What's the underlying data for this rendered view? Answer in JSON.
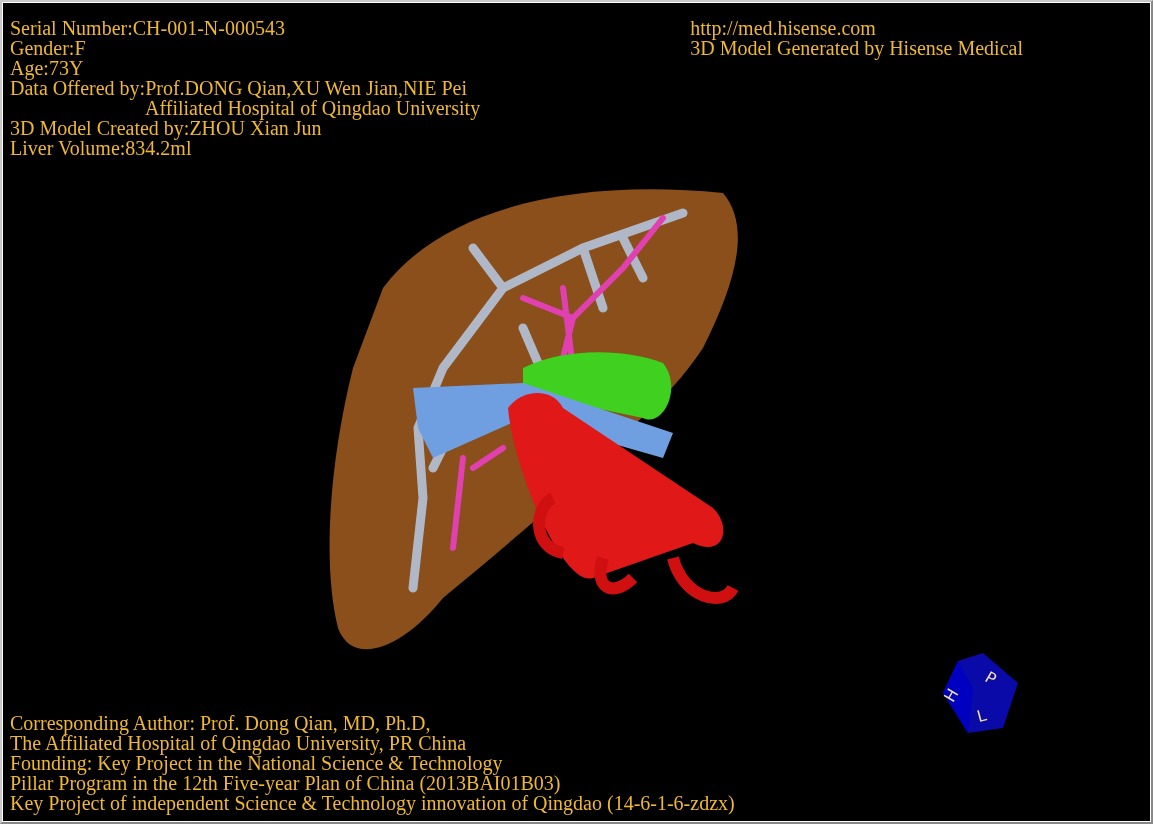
{
  "info_left": [
    {
      "text": "Serial Number:CH-001-N-000543",
      "indented": false
    },
    {
      "text": "Gender:F",
      "indented": false
    },
    {
      "text": "Age:73Y",
      "indented": false
    },
    {
      "text": "Data Offered by:Prof.DONG Qian,XU Wen Jian,NIE Pei",
      "indented": false
    },
    {
      "text": "Affiliated Hospital of Qingdao University",
      "indented": true
    },
    {
      "text": "3D Model Created by:ZHOU Xian Jun",
      "indented": false
    },
    {
      "text": "Liver Volume:834.2ml",
      "indented": false
    }
  ],
  "info_right": [
    "http://med.hisense.com",
    "3D Model Generated by Hisense Medical"
  ],
  "footer": [
    "Corresponding Author: Prof. Dong Qian, MD, Ph.D,",
    "The Affiliated Hospital of Qingdao University, PR China",
    "Founding: Key Project in the National Science & Technology",
    "Pillar Program in the 12th Five-year Plan of China (2013BAI01B03)",
    "Key Project of independent Science & Technology innovation of Qingdao (14-6-1-6-zdzx)"
  ],
  "orientation_cube": {
    "labels": [
      "H",
      "P",
      "L"
    ]
  }
}
